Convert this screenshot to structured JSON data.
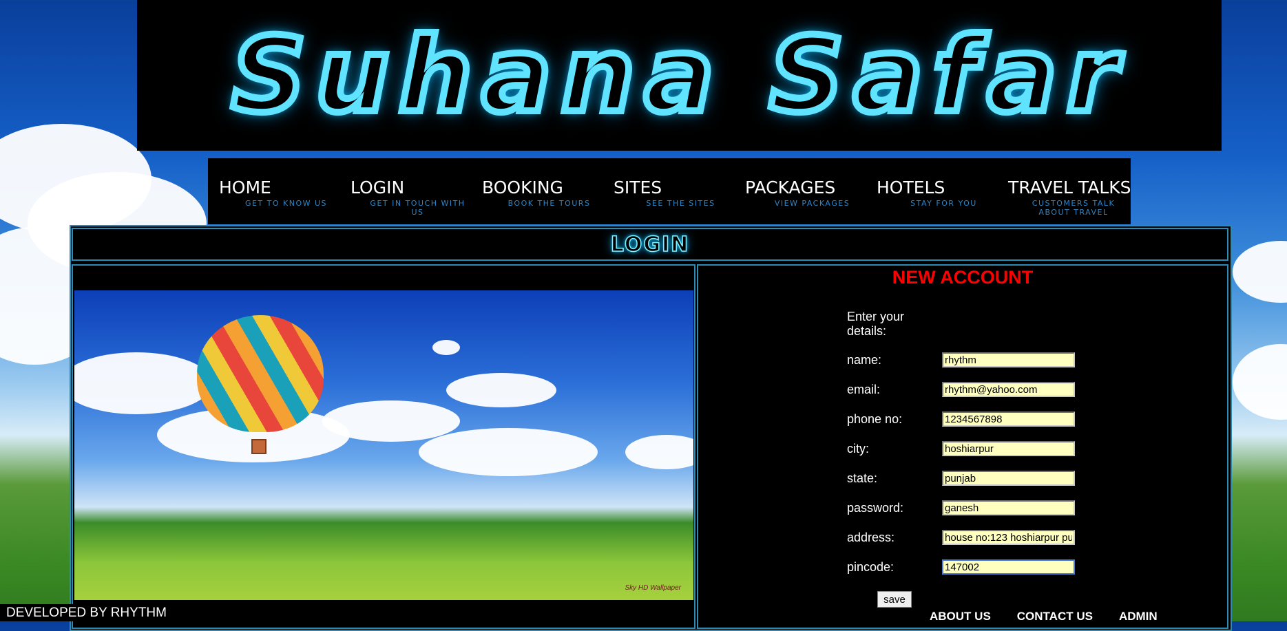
{
  "banner": {
    "title": "Suhana Safar"
  },
  "nav": {
    "items": [
      {
        "label": "HOME",
        "sub": "GET TO KNOW US"
      },
      {
        "label": "LOGIN",
        "sub": "GET IN TOUCH WITH US"
      },
      {
        "label": "BOOKING",
        "sub": "BOOK THE TOURS"
      },
      {
        "label": "SITES",
        "sub": "SEE THE SITES"
      },
      {
        "label": "PACKAGES",
        "sub": "VIEW PACKAGES"
      },
      {
        "label": "HOTELS",
        "sub": "STAY FOR YOU"
      },
      {
        "label": "TRAVEL TALKS",
        "sub": "CUSTOMERS TALK ABOUT TRAVEL"
      }
    ]
  },
  "section": {
    "heading": "LOGIN"
  },
  "image": {
    "watermark": "Sky HD Wallpaper"
  },
  "form": {
    "title": "NEW ACCOUNT",
    "intro": "Enter your details:",
    "fields": [
      {
        "label": "name:",
        "value": "rhythm"
      },
      {
        "label": "email:",
        "value": "rhythm@yahoo.com"
      },
      {
        "label": "phone no:",
        "value": "1234567898"
      },
      {
        "label": "city:",
        "value": "hoshiarpur"
      },
      {
        "label": "state:",
        "value": "punjab"
      },
      {
        "label": "password:",
        "value": "ganesh"
      },
      {
        "label": "address:",
        "value": "house no:123 hoshiarpur pun"
      },
      {
        "label": "pincode:",
        "value": "147002"
      }
    ],
    "save_label": "save"
  },
  "footer": {
    "links": [
      "ABOUT US",
      "CONTACT US",
      "ADMIN"
    ],
    "credit": "DEVELOPED BY RHYTHM"
  },
  "colors": {
    "accent": "#5fe3ff",
    "title_red": "#ff0000",
    "input_bg": "#ffffc0",
    "border": "#2b8bb5"
  }
}
